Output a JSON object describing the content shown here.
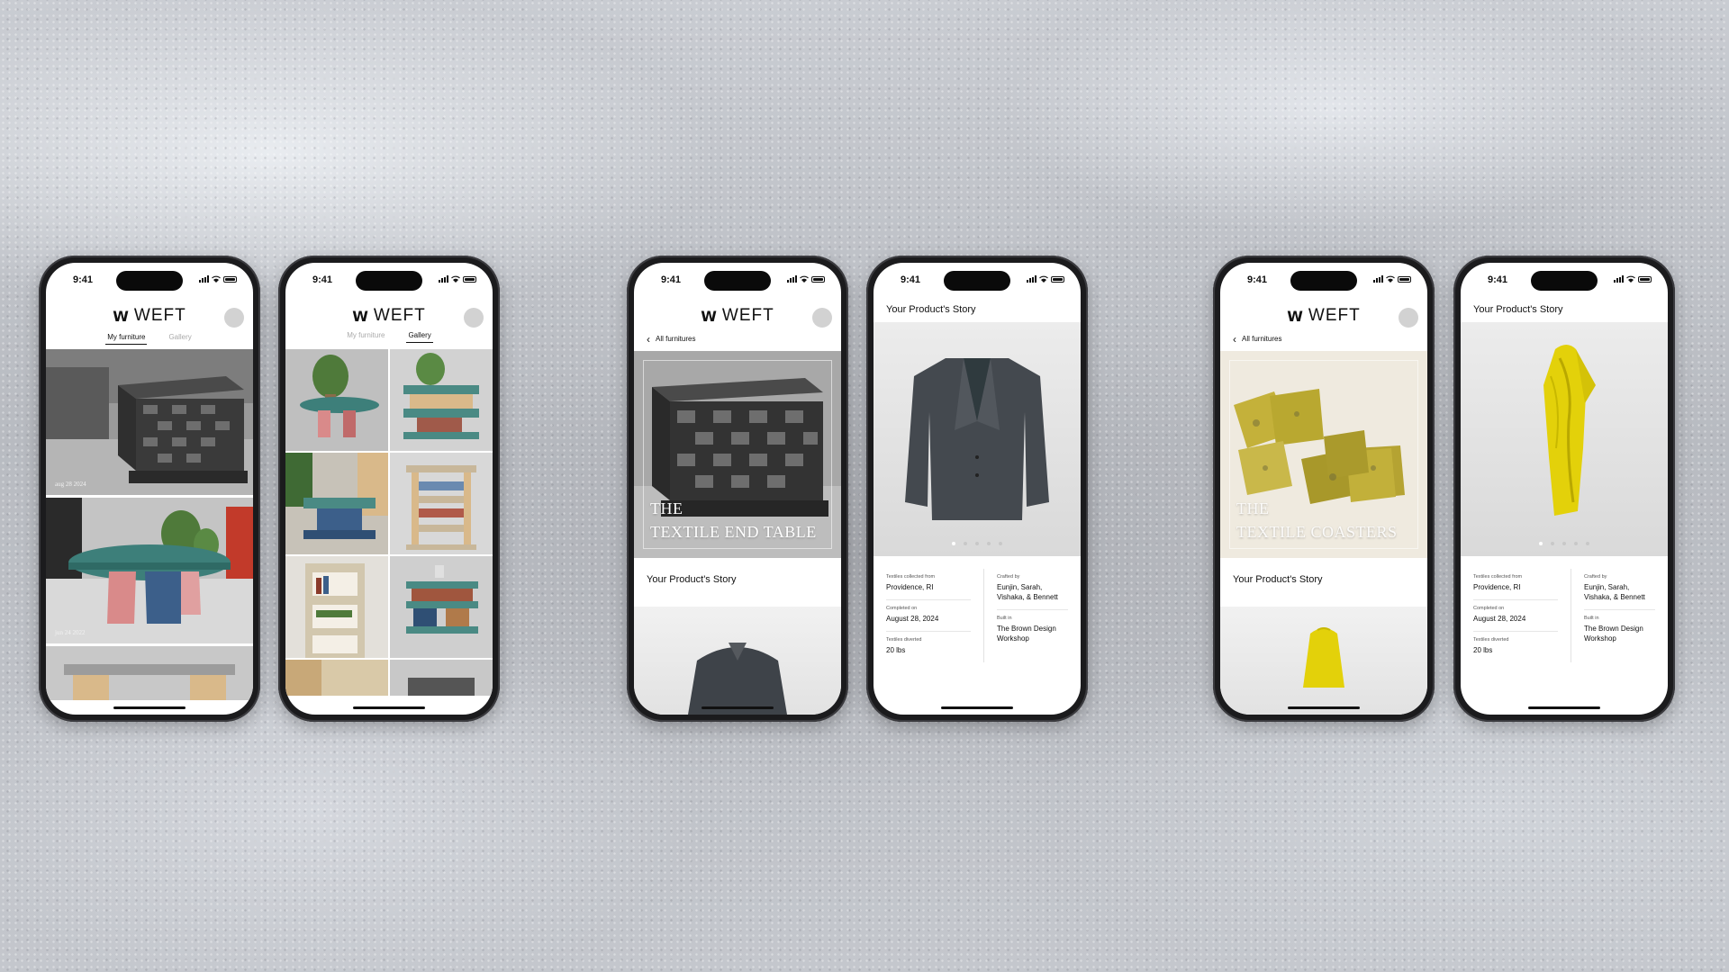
{
  "status": {
    "time": "9:41"
  },
  "brand": {
    "name": "WEFT",
    "mark": "W"
  },
  "tabs": {
    "my_furniture": "My furniture",
    "gallery": "Gallery"
  },
  "feed": {
    "dates": [
      "aug 28 2024",
      "jun 24 2022"
    ]
  },
  "nav": {
    "back_label": "All furnitures"
  },
  "products": [
    {
      "title_line1": "THE",
      "title_line2": "TEXTILE END TABLE"
    },
    {
      "title_line1": "THE",
      "title_line2": "TEXTILE COASTERS"
    }
  ],
  "story": {
    "heading": "Your Product's Story",
    "fields": {
      "textiles_from_label": "Textiles collected from",
      "textiles_from_value": "Providence, RI",
      "completed_label": "Completed on",
      "completed_value": "August 28, 2024",
      "diverted_label": "Textiles diverted",
      "diverted_value": "20 lbs",
      "crafted_label": "Crafted by",
      "crafted_value": "Eunjin, Sarah, Vishaka, & Bennett",
      "built_label": "Built in",
      "built_value": "The Brown Design Workshop"
    }
  },
  "colors": {
    "accent": "#111111",
    "coaster": "#c9b23c",
    "dress": "#e3d10a",
    "tile": "#3d7f7a"
  }
}
